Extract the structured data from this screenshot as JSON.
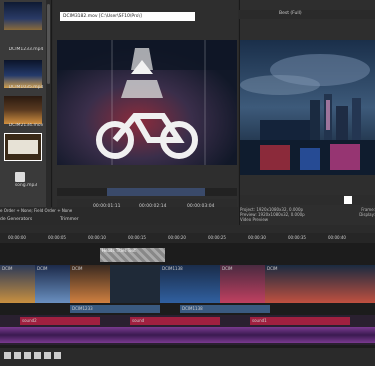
{
  "bin": {
    "items": [
      {
        "label": "DCIM1233.mp4"
      },
      {
        "label": "DCIM1035.mp4"
      },
      {
        "label": "DCIM2134.mov"
      },
      {
        "label": ""
      },
      {
        "label": "song.mp3"
      }
    ]
  },
  "trimmer": {
    "title": "DCIM3182.mov  [C:\\User\\SF10\\Pro\\]",
    "timecode_in": "00:00:01:11",
    "timecode_out": "00:00:02:14",
    "timecode_mid": "00:00:03:04"
  },
  "preview": {
    "toolbar_label": "Best (Full)",
    "project_label": "Project:",
    "project_value": "1920x1080x32, 0.000p",
    "preview_label": "Preview:",
    "preview_value": "1920x1080x32, 0.000p",
    "video_preview_tab": "Video Preview",
    "frame_label": "Frame:",
    "display_label": "Display:"
  },
  "upper_tabs": {
    "status": "e Order + None; Field Order + None",
    "trimmer_tab": "Trimmer",
    "generators_tab": "de Generators"
  },
  "timeline": {
    "ruler_marks": [
      "00:00:00",
      "00:00:05",
      "00:00:10",
      "00:00:15",
      "00:00:20",
      "00:00:25",
      "00:00:30",
      "00:00:35",
      "00:00:40"
    ],
    "title_clip": "Heads Titles Text",
    "clip_labels": [
      "DCIM",
      "DCIM",
      "DCIM",
      "DCIM1138",
      "DCIM",
      "DCIM"
    ],
    "lower_clip_labels": [
      "DCIM1233",
      "DCIM1138"
    ],
    "audio_labels": [
      "sound2",
      "sound",
      "sound1"
    ]
  }
}
